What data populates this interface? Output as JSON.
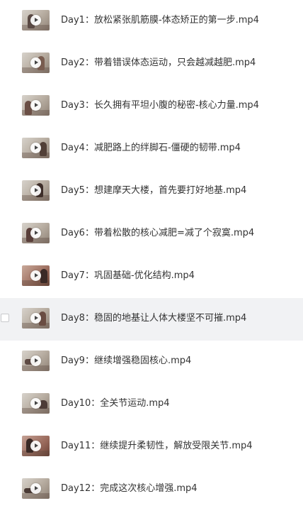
{
  "files": [
    {
      "name": "Day1：放松紧张肌筋膜-体态矫正的第一步.mp4",
      "thumb_icon": "video-thumbnail",
      "hovered": false
    },
    {
      "name": "Day2：带着错误体态运动，只会越减越肥.mp4",
      "thumb_icon": "video-thumbnail",
      "hovered": false
    },
    {
      "name": "Day3：长久拥有平坦小腹的秘密-核心力量.mp4",
      "thumb_icon": "video-thumbnail",
      "hovered": false
    },
    {
      "name": "Day4：减肥路上的绊脚石-僵硬的韧带.mp4",
      "thumb_icon": "video-thumbnail",
      "hovered": false
    },
    {
      "name": "Day5：想建摩天大楼，首先要打好地基.mp4",
      "thumb_icon": "video-thumbnail",
      "hovered": false
    },
    {
      "name": "Day6：带着松散的核心减肥=减了个寂寞.mp4",
      "thumb_icon": "video-thumbnail",
      "hovered": false
    },
    {
      "name": "Day7：巩固基础-优化结构.mp4",
      "thumb_icon": "video-thumbnail",
      "hovered": false
    },
    {
      "name": "Day8：稳固的地基让人体大楼坚不可摧.mp4",
      "thumb_icon": "video-thumbnail",
      "hovered": true
    },
    {
      "name": "Day9：继续增强稳固核心.mp4",
      "thumb_icon": "video-thumbnail",
      "hovered": false
    },
    {
      "name": "Day10：全关节运动.mp4",
      "thumb_icon": "video-thumbnail",
      "hovered": false
    },
    {
      "name": "Day11：继续提升柔韧性，解放受限关节.mp4",
      "thumb_icon": "video-thumbnail",
      "hovered": false
    },
    {
      "name": "Day12：完成这次核心增强.mp4",
      "thumb_icon": "video-thumbnail",
      "hovered": false
    }
  ],
  "colors": {
    "text": "#333333",
    "hover_background": "#f1f2f4",
    "checkbox_border": "#c8c9cc"
  }
}
